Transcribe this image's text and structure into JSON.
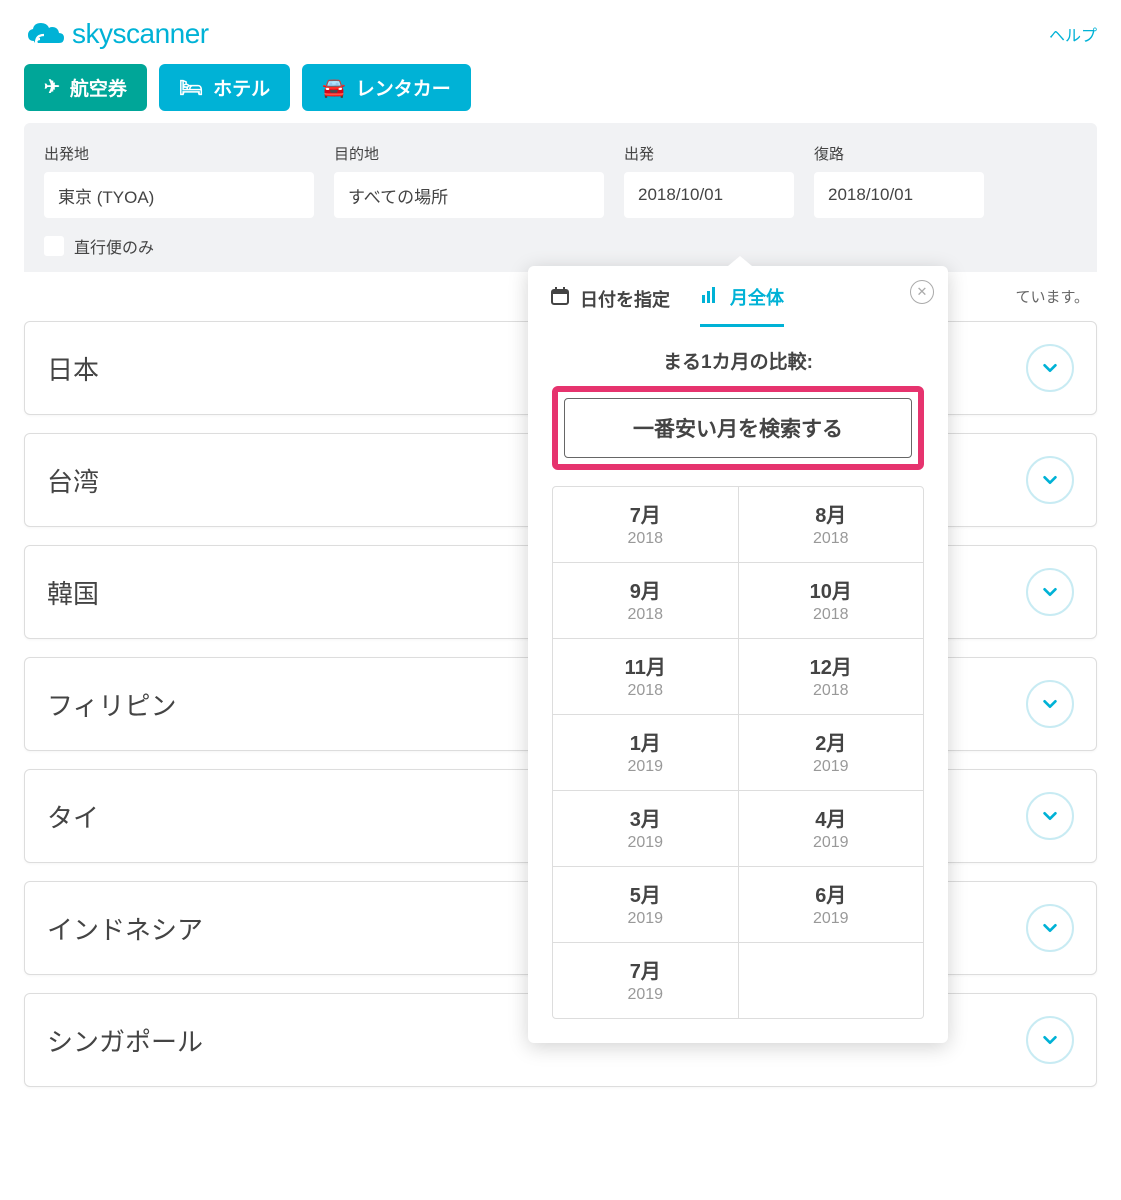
{
  "header": {
    "brand": "skyscanner",
    "help": "ヘルプ"
  },
  "tabs": {
    "flights": "航空券",
    "hotels": "ホテル",
    "cars": "レンタカー"
  },
  "search": {
    "from_label": "出発地",
    "from_value": "東京 (TYOA)",
    "to_label": "目的地",
    "to_value": "すべての場所",
    "depart_label": "出発",
    "depart_value": "2018/10/01",
    "return_label": "復路",
    "return_value": "2018/10/01",
    "direct_only": "直行便のみ"
  },
  "results_note": "ています。",
  "results": [
    "日本",
    "台湾",
    "韓国",
    "フィリピン",
    "タイ",
    "インドネシア",
    "シンガポール"
  ],
  "popover": {
    "tab_specific": "日付を指定",
    "tab_month": "月全体",
    "compare_title": "まる1カ月の比較:",
    "cheapest_btn": "一番安い月を検索する",
    "months": [
      {
        "m": "7月",
        "y": "2018"
      },
      {
        "m": "8月",
        "y": "2018"
      },
      {
        "m": "9月",
        "y": "2018"
      },
      {
        "m": "10月",
        "y": "2018"
      },
      {
        "m": "11月",
        "y": "2018"
      },
      {
        "m": "12月",
        "y": "2018"
      },
      {
        "m": "1月",
        "y": "2019"
      },
      {
        "m": "2月",
        "y": "2019"
      },
      {
        "m": "3月",
        "y": "2019"
      },
      {
        "m": "4月",
        "y": "2019"
      },
      {
        "m": "5月",
        "y": "2019"
      },
      {
        "m": "6月",
        "y": "2019"
      },
      {
        "m": "7月",
        "y": "2019"
      }
    ]
  }
}
